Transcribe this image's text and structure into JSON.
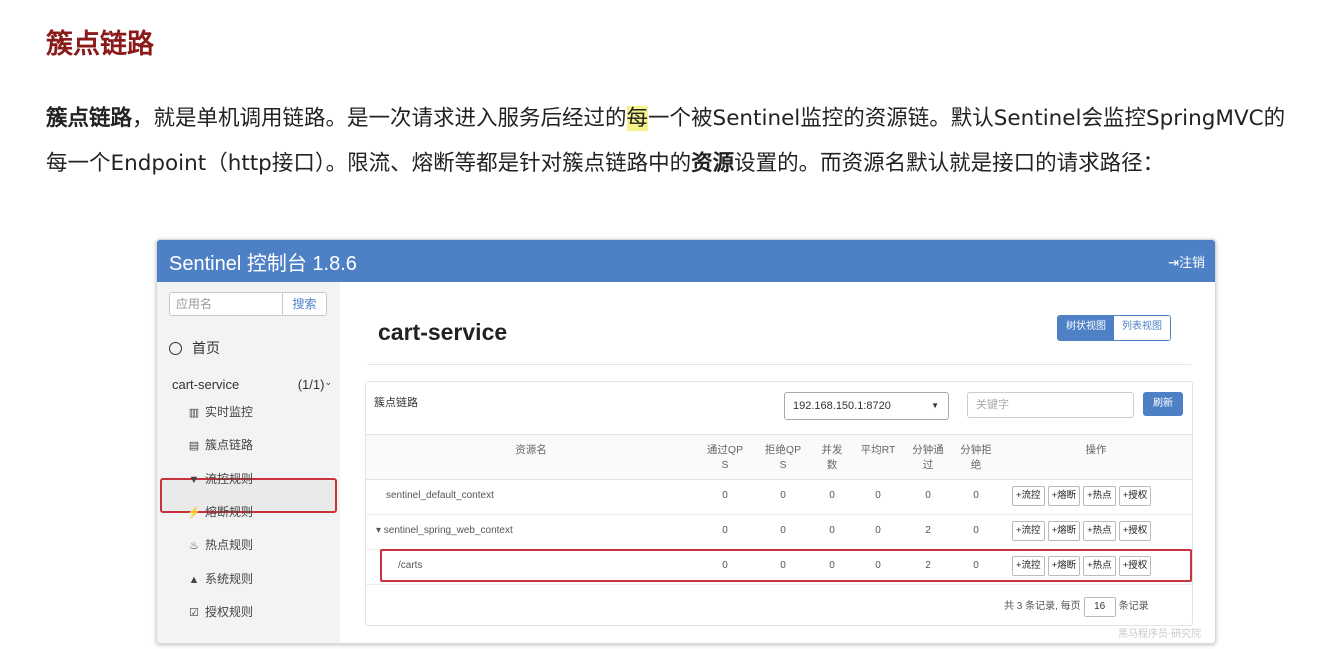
{
  "doc": {
    "title": "簇点链路",
    "para_bold": "簇点链路",
    "para_1": "，就是单机调用链路。是一次请求进入服务后经过的",
    "para_hl": "每",
    "para_2": "一个被Sentinel监控的资源链。默认Sentinel会监控SpringMVC的每一个Endpoint（http接口）。限流、熔断等都是针对簇点链路中的",
    "para_bold2": "资源",
    "para_3": "设置的。而资源名默认就是接口的请求路径："
  },
  "app": {
    "brand": "Sentinel 控制台 1.8.6",
    "logout": "注销",
    "logout_icon": "logout-arrow-icon"
  },
  "sidebar": {
    "search_placeholder": "应用名",
    "search_button": "搜索",
    "home": "首页",
    "app_name": "cart-service",
    "app_count": "(1/1)",
    "items": [
      {
        "icon": "chart-icon",
        "glyph": "▥",
        "label": "实时监控"
      },
      {
        "icon": "list-icon",
        "glyph": "▤",
        "label": "簇点链路"
      },
      {
        "icon": "filter-icon",
        "glyph": "▼",
        "label": "流控规则"
      },
      {
        "icon": "bolt-icon",
        "glyph": "⚡",
        "label": "熔断规则"
      },
      {
        "icon": "fire-icon",
        "glyph": "♨",
        "label": "热点规则"
      },
      {
        "icon": "lock-icon",
        "glyph": "▲",
        "label": "系统规则"
      },
      {
        "icon": "check-icon",
        "glyph": "☑",
        "label": "授权规则"
      }
    ]
  },
  "main": {
    "title": "cart-service",
    "view_tree": "树状视图",
    "view_list": "列表视图",
    "panel_title": "簇点链路",
    "ip_select": "192.168.150.1:8720",
    "keyword_placeholder": "关键字",
    "refresh": "刷新",
    "columns": {
      "name": "资源名",
      "pass_qps": "通过QP\nS",
      "block_qps": "拒绝QP\nS",
      "concurrency": "并发\n数",
      "avg_rt": "平均RT",
      "min_pass": "分钟通\n过",
      "min_block": "分钟拒\n绝",
      "ops": "操作"
    },
    "rows": [
      {
        "name": "sentinel_default_context",
        "pass_qps": "0",
        "block_qps": "0",
        "concurrency": "0",
        "avg_rt": "0",
        "min_pass": "0",
        "min_block": "0"
      },
      {
        "name": "▾ sentinel_spring_web_context",
        "pass_qps": "0",
        "block_qps": "0",
        "concurrency": "0",
        "avg_rt": "0",
        "min_pass": "2",
        "min_block": "0"
      },
      {
        "name": "/carts",
        "pass_qps": "0",
        "block_qps": "0",
        "concurrency": "0",
        "avg_rt": "0",
        "min_pass": "2",
        "min_block": "0"
      }
    ],
    "ops": [
      "+流控",
      "+熔断",
      "+热点",
      "+授权"
    ],
    "pager_prefix": "共 3 条记录, 每页",
    "page_size": "16",
    "pager_suffix": "条记录"
  },
  "watermark": "黑马程序员·研究院"
}
